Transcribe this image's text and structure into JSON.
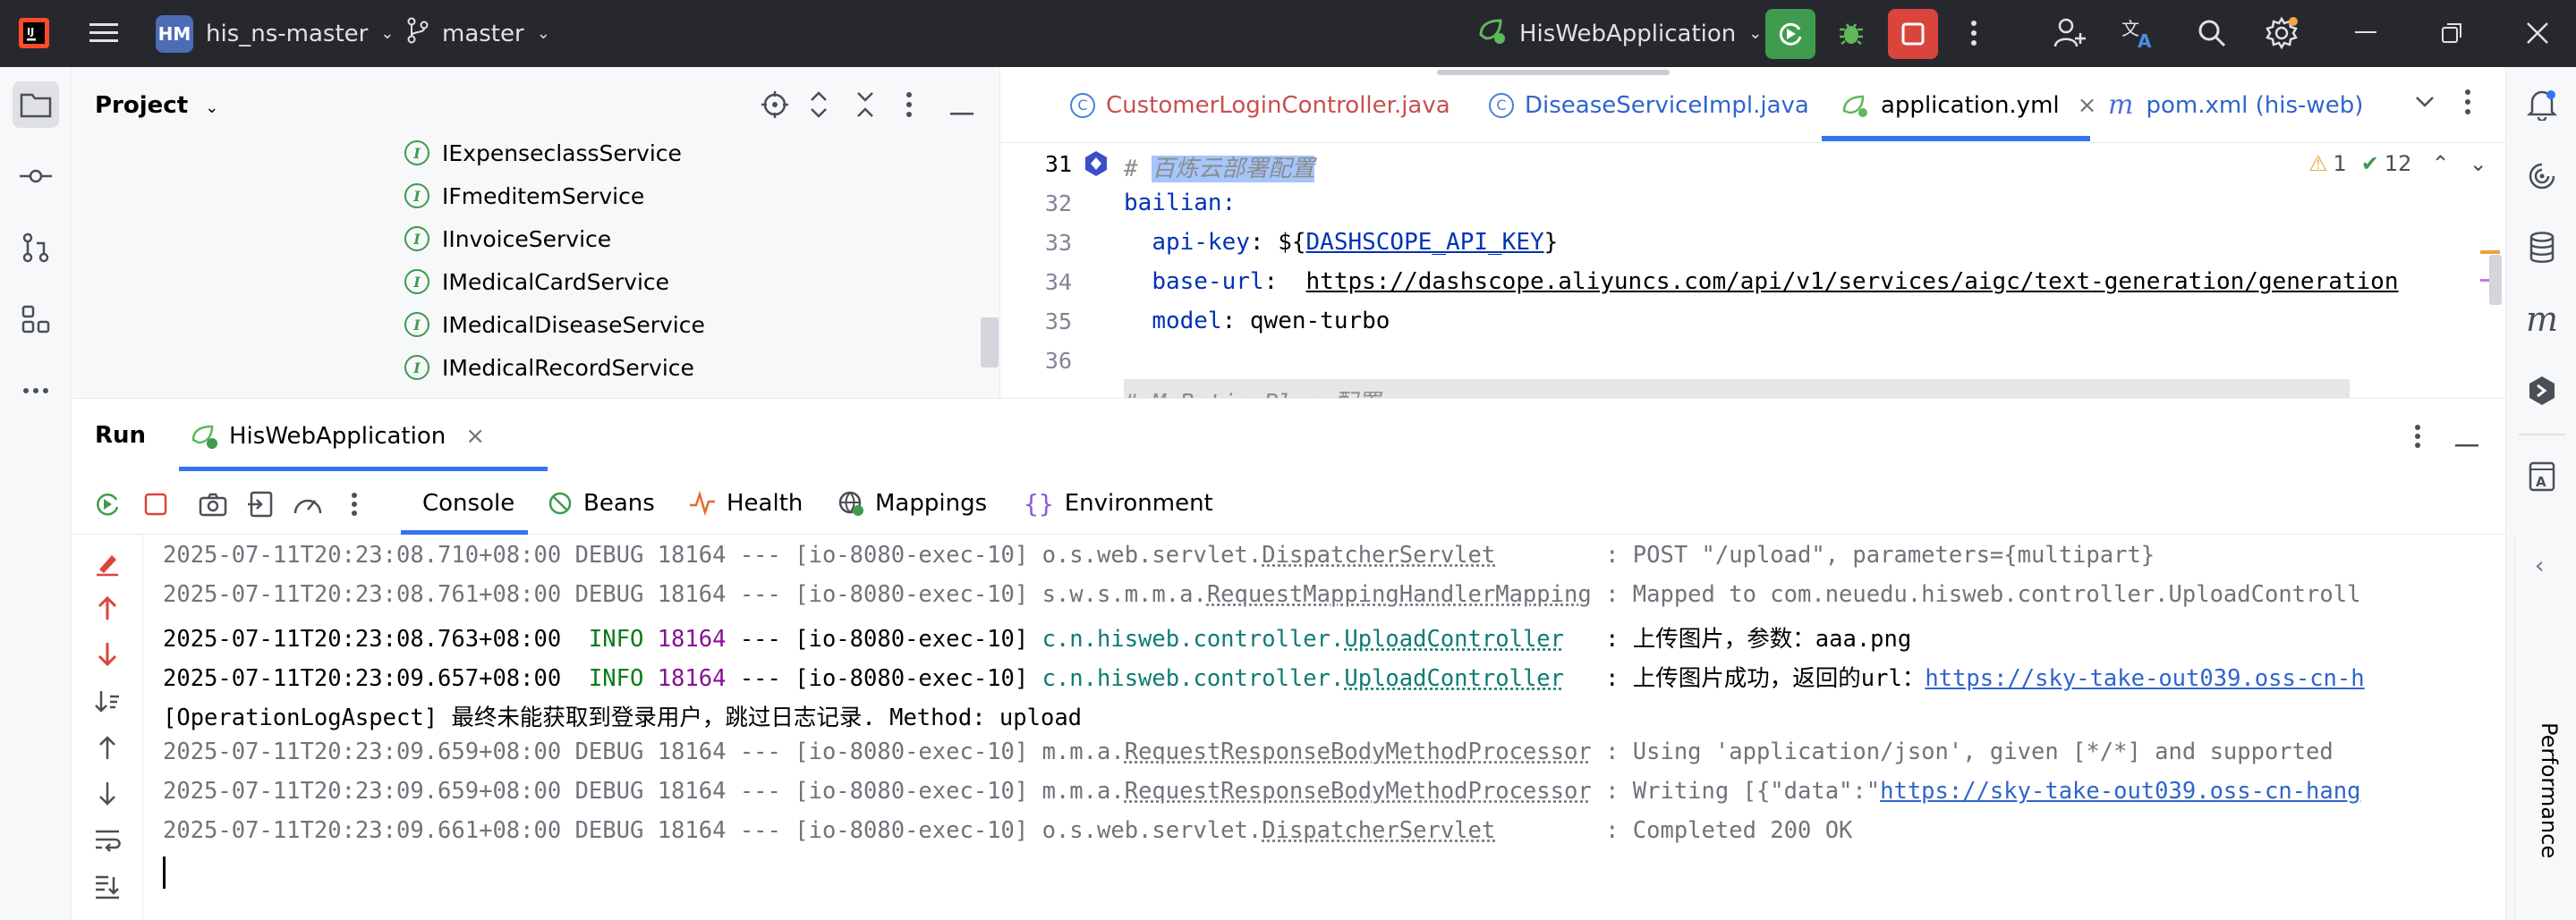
{
  "titlebar": {
    "project_badge": "HM",
    "project_name": "his_ns-master",
    "branch": "master",
    "run_config": "HisWebApplication"
  },
  "project": {
    "title": "Project",
    "tree": [
      "IExpenseclassService",
      "IFmeditemService",
      "IInvoiceService",
      "IMedicalCardService",
      "IMedicalDiseaseService",
      "IMedicalRecordService"
    ]
  },
  "editor": {
    "tabs": [
      {
        "label": "CustomerLoginController.java"
      },
      {
        "label": "DiseaseServiceImpl.java"
      },
      {
        "label": "application.yml"
      },
      {
        "label": "pom.xml (his-web)"
      }
    ],
    "warnings": "1",
    "checks": "12",
    "lines": [
      {
        "num": "31",
        "text": "# 百炼云部署配置"
      },
      {
        "num": "32",
        "text": "bailian:"
      },
      {
        "num": "33",
        "key": "api-key",
        "value": "${DASHSCOPE_API_KEY}"
      },
      {
        "num": "34",
        "key": "base-url",
        "value": "https://dashscope.aliyuncs.com/api/v1/services/aigc/text-generation/generation"
      },
      {
        "num": "35",
        "key": "model",
        "value": "qwen-turbo"
      },
      {
        "num": "36",
        "text": ""
      }
    ],
    "partial_line": "# MyBatis Plus 配置"
  },
  "run": {
    "title": "Run",
    "config_tab": "HisWebApplication",
    "tabs": [
      "Console",
      "Beans",
      "Health",
      "Mappings",
      "Environment"
    ],
    "perf_label": "Performance",
    "logs": [
      {
        "ts": "2025-07-11T20:23:08.710+08:00",
        "level": "DEBUG",
        "pid": "18164",
        "sep": "---",
        "thread": "[io-8080-exec-10]",
        "pkg": "o.s.web.servlet.",
        "cls": "DispatcherServlet",
        "pad": "        ",
        "msg": ": POST \"/upload\", parameters={multipart}"
      },
      {
        "ts": "2025-07-11T20:23:08.761+08:00",
        "level": "DEBUG",
        "pid": "18164",
        "sep": "---",
        "thread": "[io-8080-exec-10]",
        "pkg": "s.w.s.m.m.a.",
        "cls": "RequestMappingHandlerMapping",
        "pad": " ",
        "msg": ": Mapped to com.neuedu.hisweb.controller.UploadControll"
      },
      {
        "ts": "2025-07-11T20:23:08.763+08:00",
        "level": "INFO",
        "pid": "18164",
        "sep": "---",
        "thread": "[io-8080-exec-10]",
        "pkg": "c.n.hisweb.controller.",
        "cls": "UploadController",
        "pad": "   ",
        "msg": ": 上传图片，参数：aaa.png"
      },
      {
        "ts": "2025-07-11T20:23:09.657+08:00",
        "level": "INFO",
        "pid": "18164",
        "sep": "---",
        "thread": "[io-8080-exec-10]",
        "pkg": "c.n.hisweb.controller.",
        "cls": "UploadController",
        "pad": "   ",
        "msg": ": 上传图片成功，返回的url：",
        "link": "https://sky-take-out039.oss-cn-h"
      },
      {
        "plain": "[OperationLogAspect] 最终未能获取到登录用户，跳过日志记录. Method: upload"
      },
      {
        "ts": "2025-07-11T20:23:09.659+08:00",
        "level": "DEBUG",
        "pid": "18164",
        "sep": "---",
        "thread": "[io-8080-exec-10]",
        "pkg": "m.m.a.",
        "cls": "RequestResponseBodyMethodProcessor",
        "pad": " ",
        "msg": ": Using 'application/json', given [*/*] and supported"
      },
      {
        "ts": "2025-07-11T20:23:09.659+08:00",
        "level": "DEBUG",
        "pid": "18164",
        "sep": "---",
        "thread": "[io-8080-exec-10]",
        "pkg": "m.m.a.",
        "cls": "RequestResponseBodyMethodProcessor",
        "pad": " ",
        "msg": ": Writing [{\"data\":\"",
        "link": "https://sky-take-out039.oss-cn-hang"
      },
      {
        "ts": "2025-07-11T20:23:09.661+08:00",
        "level": "DEBUG",
        "pid": "18164",
        "sep": "---",
        "thread": "[io-8080-exec-10]",
        "pkg": "o.s.web.servlet.",
        "cls": "DispatcherServlet",
        "pad": "        ",
        "msg": ": Completed 200 OK"
      }
    ]
  },
  "colors": {
    "titlebar_bg": "#27282e",
    "run_green": "#3f9b4d",
    "stop_red": "#d9453c",
    "link_blue": "#2f65ca",
    "info_green": "#067d17"
  }
}
